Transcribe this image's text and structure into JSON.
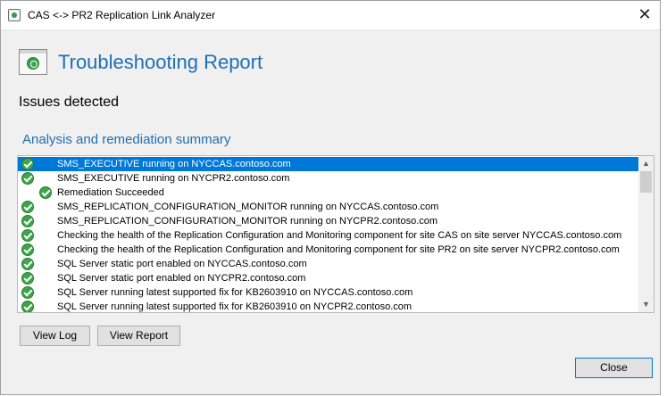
{
  "window": {
    "title": "CAS <-> PR2 Replication Link Analyzer",
    "close_glyph": "✕"
  },
  "header": {
    "heading": "Troubleshooting Report",
    "status": "Issues detected",
    "section_title": "Analysis and remediation summary"
  },
  "results": [
    {
      "text": "SMS_EXECUTIVE running on NYCCAS.contoso.com",
      "icon": "check-icon",
      "indent": 0,
      "selected": true
    },
    {
      "text": "SMS_EXECUTIVE running on NYCPR2.contoso.com",
      "icon": "check-icon",
      "indent": 0,
      "selected": false
    },
    {
      "text": "Remediation Succeeded",
      "icon": "check-icon",
      "indent": 1,
      "selected": false
    },
    {
      "text": "SMS_REPLICATION_CONFIGURATION_MONITOR running on NYCCAS.contoso.com",
      "icon": "check-icon",
      "indent": 0,
      "selected": false
    },
    {
      "text": "SMS_REPLICATION_CONFIGURATION_MONITOR running on NYCPR2.contoso.com",
      "icon": "check-icon",
      "indent": 0,
      "selected": false
    },
    {
      "text": "Checking the health of the Replication Configuration and Monitoring component for site CAS on site server NYCCAS.contoso.com",
      "icon": "check-icon",
      "indent": 0,
      "selected": false
    },
    {
      "text": "Checking the health of the Replication Configuration and Monitoring component for site PR2 on site server NYCPR2.contoso.com",
      "icon": "check-icon",
      "indent": 0,
      "selected": false
    },
    {
      "text": "SQL Server static port enabled on NYCCAS.contoso.com",
      "icon": "check-icon",
      "indent": 0,
      "selected": false
    },
    {
      "text": "SQL Server static port enabled on NYCPR2.contoso.com",
      "icon": "check-icon",
      "indent": 0,
      "selected": false
    },
    {
      "text": "SQL Server running latest supported fix for KB2603910 on NYCCAS.contoso.com",
      "icon": "check-icon",
      "indent": 0,
      "selected": false
    },
    {
      "text": "SQL Server running latest supported fix for KB2603910 on NYCPR2.contoso.com",
      "icon": "check-icon",
      "indent": 0,
      "selected": false
    }
  ],
  "buttons": {
    "view_log": "View Log",
    "view_report": "View Report",
    "close": "Close"
  },
  "colors": {
    "accent": "#1e6fb4",
    "selection": "#0078d7",
    "check": "#3ea54a"
  }
}
